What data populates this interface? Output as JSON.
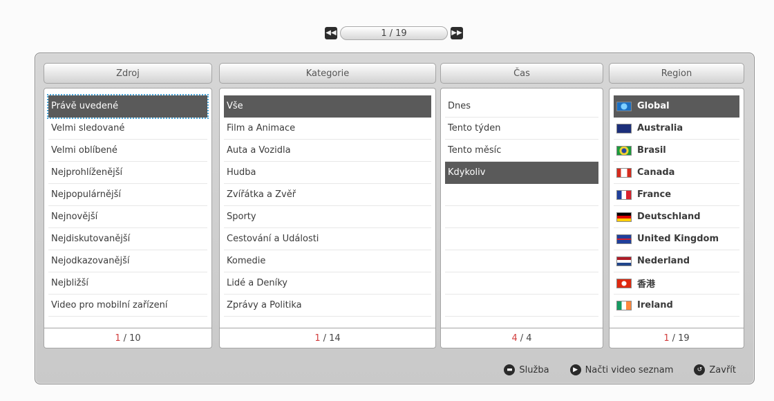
{
  "pager": {
    "current": "1",
    "separator": "/",
    "total": "19",
    "prev_icon": "rewind-icon",
    "next_icon": "fast-forward-icon"
  },
  "columns": {
    "zdroj": {
      "header": "Zdroj",
      "items": [
        "Právě uvedené",
        "Velmi sledované",
        "Velmi oblíbené",
        "Nejprohlíženější",
        "Nejpopulárnější",
        "Nejnovější",
        "Nejdiskutovanější",
        "Nejodkazovanější",
        "Nejbližší",
        "Video pro mobilní zařízení"
      ],
      "page_current": "1",
      "page_total": "10"
    },
    "kategorie": {
      "header": "Kategorie",
      "items": [
        "Vše",
        "Film a Animace",
        "Auta a Vozidla",
        "Hudba",
        "Zvířátka a Zvěř",
        "Sporty",
        "Cestování a Události",
        "Komedie",
        "Lidé a Deníky",
        "Zprávy a Politika"
      ],
      "page_current": "1",
      "page_total": "14"
    },
    "cas": {
      "header": "Čas",
      "items": [
        "Dnes",
        "Tento týden",
        "Tento měsíc",
        "Kdykoliv"
      ],
      "page_current": "4",
      "page_total": "4"
    },
    "region": {
      "header": "Region",
      "items": [
        "Global",
        "Australia",
        "Brasil",
        "Canada",
        "France",
        "Deutschland",
        "United Kingdom",
        "Nederland",
        "香港",
        "Ireland"
      ],
      "page_current": "1",
      "page_total": "19"
    }
  },
  "actions": {
    "service_label": "Služba",
    "load_label": "Načti video seznam",
    "close_label": "Zavřít"
  },
  "colors": {
    "selected_bg": "#5a5a5a",
    "page_current": "#d23c3c",
    "focus_outline": "#49a5d8"
  }
}
